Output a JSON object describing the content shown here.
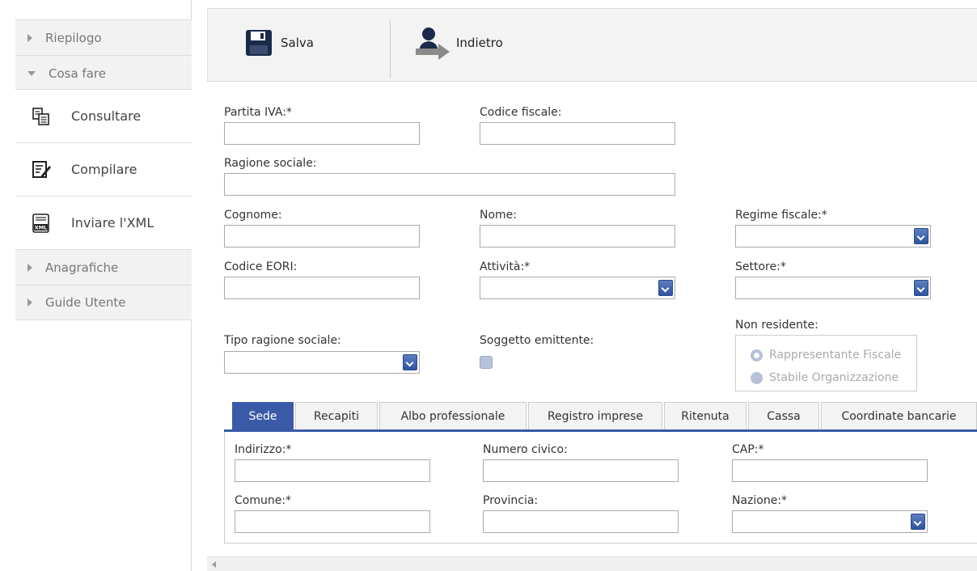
{
  "sidebar": {
    "sections": {
      "riepilogo": "Riepilogo",
      "cosa_fare": "Cosa fare",
      "anagrafiche": "Anagrafiche",
      "guide": "Guide Utente"
    },
    "items": [
      {
        "label": "Consultare",
        "icon": "documents-icon"
      },
      {
        "label": "Compilare",
        "icon": "edit-form-icon"
      },
      {
        "label": "Inviare l'XML",
        "icon": "xml-file-icon"
      }
    ]
  },
  "toolbar": {
    "save_label": "Salva",
    "back_label": "Indietro"
  },
  "form": {
    "partita_iva": "Partita IVA:*",
    "codice_fiscale": "Codice fiscale:",
    "ragione_sociale": "Ragione sociale:",
    "cognome": "Cognome:",
    "nome": "Nome:",
    "regime_fiscale": "Regime fiscale:*",
    "codice_eori": "Codice EORI:",
    "attivita": "Attività:*",
    "settore": "Settore:*",
    "non_residente": "Non residente:",
    "tipo_ragione_sociale": "Tipo ragione sociale:",
    "soggetto_emittente": "Soggetto emittente:",
    "rappresentante_fiscale": "Rappresentante Fiscale",
    "stabile_organizzazione": "Stabile Organizzazione"
  },
  "tabs": [
    "Sede",
    "Recapiti",
    "Albo professionale",
    "Registro imprese",
    "Ritenuta",
    "Cassa",
    "Coordinate bancarie"
  ],
  "sede": {
    "indirizzo": "Indirizzo:*",
    "numero_civico": "Numero civico:",
    "cap": "CAP:*",
    "comune": "Comune:*",
    "provincia": "Provincia:",
    "nazione": "Nazione:*"
  },
  "colors": {
    "accent": "#3a5aa8",
    "toolbar_bg": "#f3f3f3"
  }
}
